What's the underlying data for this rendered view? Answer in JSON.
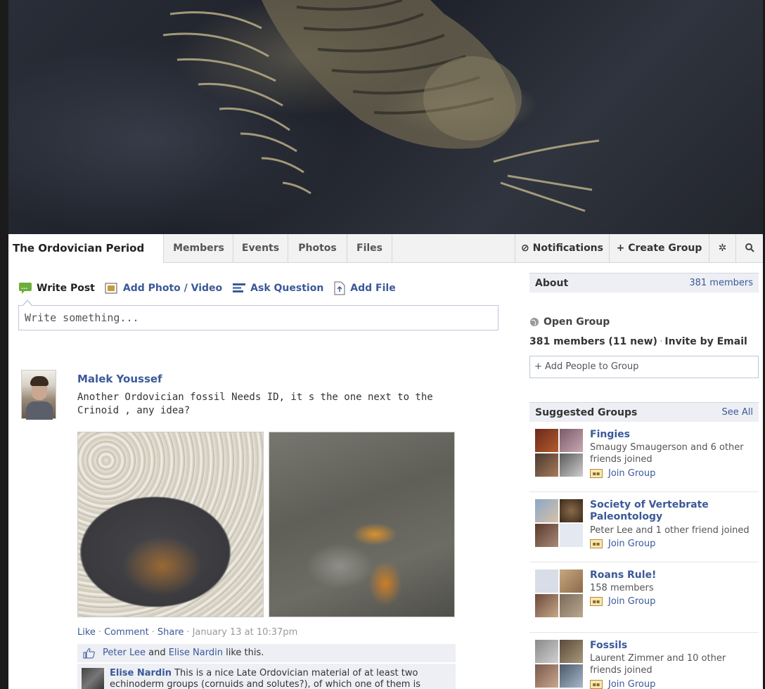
{
  "group": {
    "title": "The Ordovician Period",
    "tabs": [
      {
        "label": "Members"
      },
      {
        "label": "Events"
      },
      {
        "label": "Photos"
      },
      {
        "label": "Files"
      }
    ],
    "notifications_label": "Notifications",
    "create_group_label": "Create Group"
  },
  "composer": {
    "write_post": "Write Post",
    "add_photo": "Add Photo / Video",
    "ask_question": "Ask Question",
    "add_file": "Add File",
    "placeholder": "Write something..."
  },
  "post": {
    "author": "Malek Youssef",
    "text": "Another Ordovician fossil Needs ID, it s the one next to the Crinoid , any idea?",
    "actions": [
      "Like",
      "Comment",
      "Share"
    ],
    "timestamp": "January 13 at 10:37pm",
    "likers": [
      "Peter Lee",
      "Elise Nardin"
    ],
    "likes_connector": "and",
    "likes_suffix": "like this.",
    "comment": {
      "author": "Elise Nardin",
      "text": "This is a nice Late Ordovician material of at least two echinoderm groups (cornuids and solutes?), of which one of them is"
    }
  },
  "sidebar": {
    "about_title": "About",
    "about_members": "381 members",
    "privacy": "Open Group",
    "members_count": "381 members (11 new)",
    "invite": "Invite by Email",
    "add_people": "+ Add People to Group",
    "suggested_title": "Suggested Groups",
    "see_all": "See All",
    "join_label": "Join Group",
    "groups": [
      {
        "name": "Fingies",
        "meta": "Smaugy Smaugerson and 6 other friends joined"
      },
      {
        "name": "Society of Vertebrate Paleontology",
        "meta": "Peter Lee and 1 other friend joined"
      },
      {
        "name": "Roans Rule!",
        "meta": "158 members"
      },
      {
        "name": "Fossils",
        "meta": "Laurent Zimmer and 10 other friends joined"
      }
    ]
  },
  "colors": {
    "link": "#3b5998",
    "nav_bg": "#f2f2f2",
    "panel_bg": "#edeff4"
  }
}
